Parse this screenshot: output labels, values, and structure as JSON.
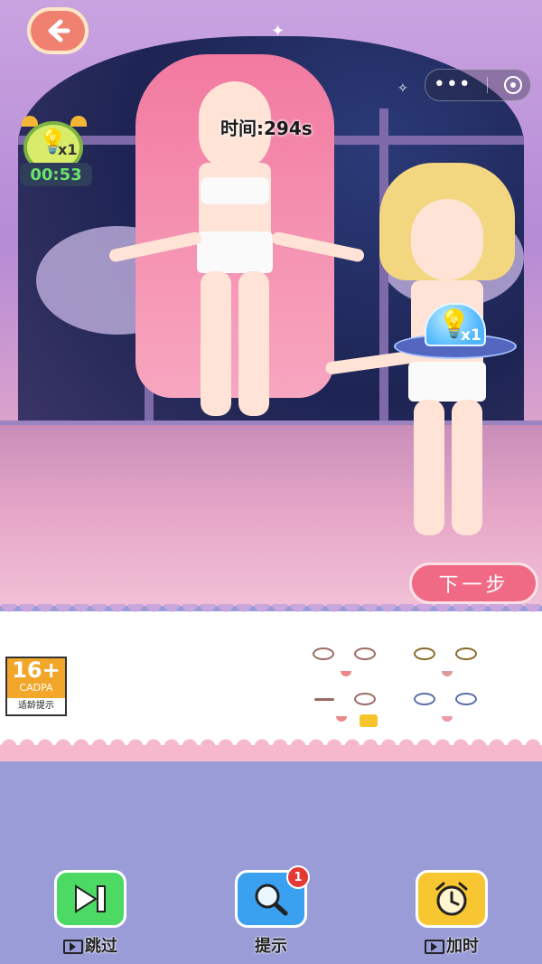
{
  "game": {
    "timer_label": "时间:294s",
    "back_icon": "arrow-left-icon",
    "mini_menu": {
      "more_icon": "more-dots-icon",
      "close_icon": "record-icon"
    }
  },
  "bonus": {
    "clock_multiplier": "x1",
    "clock_time": "00:53",
    "hint_multiplier": "x1"
  },
  "actions": {
    "next_step_label": "下一步"
  },
  "age_rating": {
    "number": "16+",
    "org": "CADPA",
    "note": "适龄提示"
  },
  "faces": [
    {
      "name": "face-option-pink-eyes"
    },
    {
      "name": "face-option-gold-eyes"
    },
    {
      "name": "face-option-wink"
    },
    {
      "name": "face-option-blue-eyes"
    }
  ],
  "toolbar": {
    "skip_label": "跳过",
    "hint_label": "提示",
    "hint_badge": "1",
    "addtime_label": "加时"
  },
  "colors": {
    "next_button": "#f06a86",
    "skip_button": "#4cd964",
    "hint_button": "#3aa0f0",
    "addtime_button": "#f7c630",
    "timer_green": "#69e36b"
  }
}
